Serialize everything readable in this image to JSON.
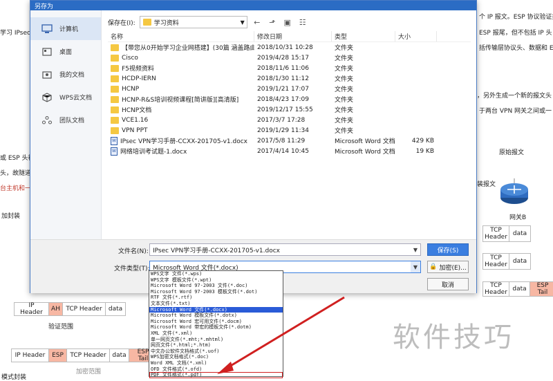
{
  "background": {
    "left_snippets": [
      "学习 IPsec V",
      "或 ESP 头被",
      "头，故隧道",
      "台主机和一",
      "加封装"
    ],
    "right_snippets": [
      "个 IP 报文。ESP 协议验证报",
      "ESP 报尾，但不包括 IP 头",
      "括传输层协议头、数据和 E",
      "，另外生成一个新的报文头",
      "于两台 VPN 网关之间或一"
    ],
    "labels": {
      "original_packet": "原始报文",
      "encap_packet": "装报文",
      "gateway_b": "网关B",
      "auth_range": "验证范围",
      "encrypt_range": "加密范围",
      "bottom_cut": "模式封装"
    },
    "ah_row": [
      "IP Header",
      "AH",
      "TCP Header",
      "data"
    ],
    "esp_row": [
      "IP Header",
      "ESP",
      "TCP Header",
      "data",
      "ESP Tail"
    ],
    "right_tcp_rows": [
      [
        "TCP Header",
        "data"
      ],
      [
        "TCP Header",
        "data"
      ],
      [
        "TCP Header",
        "data",
        "ESP Tail"
      ]
    ]
  },
  "dialog": {
    "title": "另存为",
    "sidebar": [
      {
        "label": "计算机",
        "icon": "computer-icon"
      },
      {
        "label": "桌面",
        "icon": "desktop-icon"
      },
      {
        "label": "我的文档",
        "icon": "documents-icon"
      },
      {
        "label": "WPS云文档",
        "icon": "cloud-doc-icon"
      },
      {
        "label": "团队文档",
        "icon": "team-doc-icon"
      }
    ],
    "save_in_label": "保存在(I):",
    "save_in_value": "学习资料",
    "columns": {
      "name": "名称",
      "date": "修改日期",
      "type": "类型",
      "size": "大小"
    },
    "files": [
      {
        "name": "【带您从0开始学习企业网搭建】(30篇 涵盖路由 ...",
        "date": "2018/10/31 10:28",
        "type": "文件夹",
        "size": "",
        "kind": "folder"
      },
      {
        "name": "Cisco",
        "date": "2019/4/28 15:17",
        "type": "文件夹",
        "size": "",
        "kind": "folder"
      },
      {
        "name": "F5视频资料",
        "date": "2018/11/6 11:06",
        "type": "文件夹",
        "size": "",
        "kind": "folder"
      },
      {
        "name": "HCDP-IERN",
        "date": "2018/1/30 11:12",
        "type": "文件夹",
        "size": "",
        "kind": "folder"
      },
      {
        "name": "HCNP",
        "date": "2019/1/21 17:07",
        "type": "文件夹",
        "size": "",
        "kind": "folder"
      },
      {
        "name": "HCNP-R&S培训视频课程[简讲版][高清版]",
        "date": "2018/4/23 17:09",
        "type": "文件夹",
        "size": "",
        "kind": "folder"
      },
      {
        "name": "HCNP文档",
        "date": "2019/12/17 15:55",
        "type": "文件夹",
        "size": "",
        "kind": "folder"
      },
      {
        "name": "VCE1.16",
        "date": "2017/3/7 17:28",
        "type": "文件夹",
        "size": "",
        "kind": "folder"
      },
      {
        "name": "VPN PPT",
        "date": "2019/1/29 11:34",
        "type": "文件夹",
        "size": "",
        "kind": "folder"
      },
      {
        "name": "IPsec VPN学习手册-CCXX-201705-v1.docx",
        "date": "2017/5/8 11:29",
        "type": "Microsoft Word 文档",
        "size": "429 KB",
        "kind": "doc"
      },
      {
        "name": "网络培训考试题-1.docx",
        "date": "2017/4/14 10:45",
        "type": "Microsoft Word 文档",
        "size": "19 KB",
        "kind": "doc"
      }
    ],
    "filename_label": "文件名(N):",
    "filename_value": "IPsec VPN学习手册-CCXX-201705-v1.docx",
    "filetype_label": "文件类型(T):",
    "filetype_value": "Microsoft Word 文件(*.docx)",
    "save_button": "保存(S)",
    "encrypt_button": "加密(E)...",
    "cancel_button": "取消",
    "filetype_options": [
      "WPS文字 文件(*.wps)",
      "WPS文字 模板文件(*.wpt)",
      "Microsoft Word 97-2003 文件(*.doc)",
      "Microsoft Word 97-2003 模板文件(*.dot)",
      "RTF 文件(*.rtf)",
      "文本文件(*.txt)",
      "Microsoft Word 文件(*.docx)",
      "Microsoft Word 模板文件(*.dotx)",
      "Microsoft Word 宏可用文件(*.docm)",
      "Microsoft Word 带宏的模板文件(*.dotm)",
      "XML 文件(*.xml)",
      "单一网页文件(*.mht;*.mhtml)",
      "网页文件(*.html;*.htm)",
      "中文办公软件文档格式(*.uof)",
      "WPS加密文档格式(*.doc)",
      "Word XML 文档(*.xml)",
      "OFD 文件格式(*.ofd)",
      "PDF 文件格式(*.pdf)"
    ],
    "selected_option_index": 6,
    "highlighted_option_index": 17
  },
  "watermark": "软件技巧",
  "colors": {
    "title_bar": "#2b6cc4",
    "selection": "#2a5bd7",
    "arrow": "#d02020"
  }
}
